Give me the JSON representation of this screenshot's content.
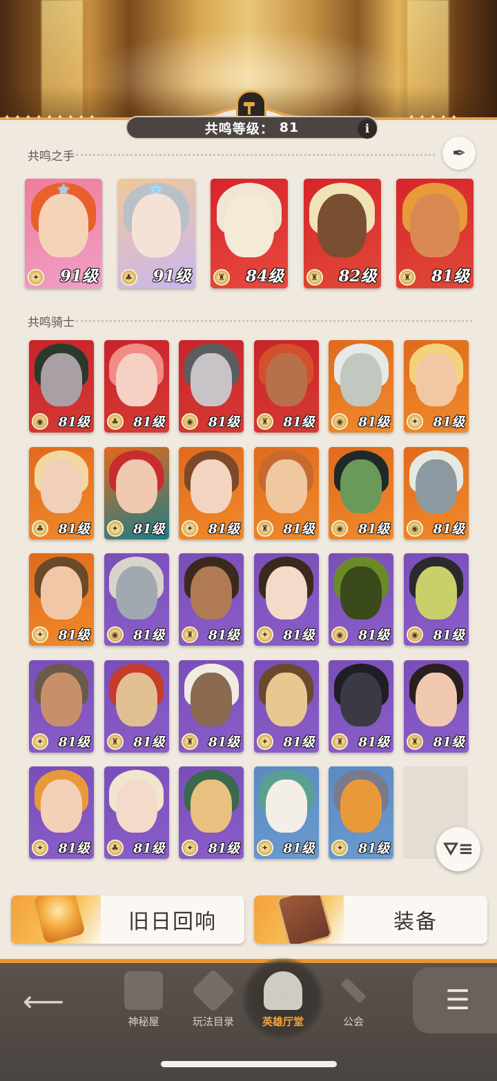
{
  "header": {
    "level_label": "共鸣等级：",
    "level_value": "81",
    "info_icon": "i"
  },
  "hands": {
    "title": "共鸣之手",
    "cards": [
      {
        "level": "91级",
        "faction": "lightbearer",
        "starred": true,
        "palette": [
          "#f07c9a",
          "#f0a0c8",
          "#e8602c",
          "#f5d3b8"
        ]
      },
      {
        "level": "91级",
        "faction": "wilder",
        "starred": true,
        "palette": [
          "#f0c89a",
          "#c8b6f0",
          "#b9c0c8",
          "#f5e2d6"
        ]
      },
      {
        "level": "84级",
        "faction": "graveborn-gold",
        "starred": false,
        "palette": [
          "#d8242a",
          "#e84a40",
          "#f1e6d4",
          "#f4ead8"
        ]
      },
      {
        "level": "82级",
        "faction": "graveborn-gold",
        "starred": false,
        "palette": [
          "#d8242a",
          "#e04a38",
          "#f1e3b8",
          "#7a4e30"
        ]
      },
      {
        "level": "81级",
        "faction": "graveborn-gold",
        "starred": false,
        "palette": [
          "#d8242a",
          "#e04a38",
          "#e99a3a",
          "#d98a52"
        ]
      }
    ]
  },
  "knights": {
    "title": "共鸣骑士",
    "cards": [
      {
        "level": "81级",
        "faction": "mauler",
        "palette": [
          "#c8242a",
          "#d63a34",
          "#2a3a2a",
          "#a8a0a4"
        ]
      },
      {
        "level": "81级",
        "faction": "wilder",
        "palette": [
          "#c8242a",
          "#d63a34",
          "#f28a86",
          "#f7d0c4"
        ]
      },
      {
        "level": "81级",
        "faction": "mauler",
        "palette": [
          "#c8242a",
          "#d63a34",
          "#5a5e62",
          "#c8c4c6"
        ]
      },
      {
        "level": "81级",
        "faction": "graveborn-gold",
        "palette": [
          "#c8242a",
          "#d63a34",
          "#d4502c",
          "#b8704a"
        ]
      },
      {
        "level": "81级",
        "faction": "mauler",
        "palette": [
          "#e06a1c",
          "#f08a2c",
          "#e8e8e8",
          "#c0c8c0"
        ]
      },
      {
        "level": "81级",
        "faction": "lightbearer",
        "palette": [
          "#e06a1c",
          "#f08a2c",
          "#f4d27a",
          "#f2c8a4"
        ]
      },
      {
        "level": "81级",
        "faction": "wilder",
        "palette": [
          "#e06a1c",
          "#f08a2c",
          "#f2d8a0",
          "#f0d0b8"
        ]
      },
      {
        "level": "81级",
        "faction": "lightbearer",
        "palette": [
          "#e06a1c",
          "#1a7e8a",
          "#c82c2c",
          "#f0c8b0"
        ]
      },
      {
        "level": "81级",
        "faction": "lightbearer",
        "palette": [
          "#e06a1c",
          "#f08a2c",
          "#7a4a2a",
          "#f2d4c0"
        ]
      },
      {
        "level": "81级",
        "faction": "graveborn-gold",
        "palette": [
          "#e06a1c",
          "#f08a2c",
          "#c86a30",
          "#f0c8a0"
        ]
      },
      {
        "level": "81级",
        "faction": "mauler",
        "palette": [
          "#e06a1c",
          "#f08a2c",
          "#1e2a2a",
          "#6a9a5a"
        ]
      },
      {
        "level": "81级",
        "faction": "mauler",
        "palette": [
          "#e06a1c",
          "#f08a2c",
          "#e8e8e2",
          "#8a9aa0"
        ]
      },
      {
        "level": "81级",
        "faction": "lightbearer",
        "palette": [
          "#e06a1c",
          "#f08a2c",
          "#6a4a2a",
          "#f0c8a8"
        ]
      },
      {
        "level": "81级",
        "faction": "mauler",
        "palette": [
          "#7a4eb8",
          "#8a5ec8",
          "#d8d4cc",
          "#a0a8b0"
        ]
      },
      {
        "level": "81级",
        "faction": "graveborn-gold",
        "palette": [
          "#7a4eb8",
          "#8a5ec8",
          "#3a2a1e",
          "#b07a52"
        ]
      },
      {
        "level": "81级",
        "faction": "lightbearer",
        "palette": [
          "#7a4eb8",
          "#8a5ec8",
          "#3a2a1e",
          "#f4dac8"
        ]
      },
      {
        "level": "81级",
        "faction": "mauler",
        "palette": [
          "#7a4eb8",
          "#8a5ec8",
          "#6a8a2a",
          "#3a4a1a"
        ]
      },
      {
        "level": "81级",
        "faction": "mauler",
        "palette": [
          "#7a4eb8",
          "#8a5ec8",
          "#2a2a2e",
          "#c8d06a"
        ]
      },
      {
        "level": "81级",
        "faction": "lightbearer",
        "palette": [
          "#7a4eb8",
          "#8a5ec8",
          "#6a5a4a",
          "#c8906a"
        ]
      },
      {
        "level": "81级",
        "faction": "graveborn-gold",
        "palette": [
          "#7a4eb8",
          "#8a5ec8",
          "#c83a2a",
          "#e0c090"
        ]
      },
      {
        "level": "81级",
        "faction": "graveborn-gold",
        "palette": [
          "#7a4eb8",
          "#8a5ec8",
          "#f0ece4",
          "#8a6a50"
        ]
      },
      {
        "level": "81级",
        "faction": "lightbearer",
        "palette": [
          "#7a4eb8",
          "#8a5ec8",
          "#6a4a2a",
          "#e8c890"
        ]
      },
      {
        "level": "81级",
        "faction": "graveborn-gold",
        "palette": [
          "#7a4eb8",
          "#8a5ec8",
          "#1e1e24",
          "#3a3a44"
        ]
      },
      {
        "level": "81级",
        "faction": "graveborn-gold",
        "palette": [
          "#7a4eb8",
          "#8a5ec8",
          "#2a1e1e",
          "#f0c8b0"
        ]
      },
      {
        "level": "81级",
        "faction": "lightbearer",
        "palette": [
          "#7a4eb8",
          "#8a5ec8",
          "#e89a3a",
          "#f4d0b8"
        ]
      },
      {
        "level": "81级",
        "faction": "wilder",
        "palette": [
          "#7a4eb8",
          "#8a5ec8",
          "#f0e6d0",
          "#f4dac8"
        ]
      },
      {
        "level": "81级",
        "faction": "lightbearer",
        "palette": [
          "#7a4eb8",
          "#8a5ec8",
          "#3a6a4a",
          "#e8c080"
        ]
      },
      {
        "level": "81级",
        "faction": "lightbearer",
        "palette": [
          "#5a8ac0",
          "#6a9ad0",
          "#5aa090",
          "#f4eee8"
        ]
      },
      {
        "level": "81级",
        "faction": "lightbearer",
        "palette": [
          "#5a8ac0",
          "#6a9ad0",
          "#7a7a8a",
          "#e89a3a"
        ]
      }
    ]
  },
  "actions": {
    "echoes_label": "旧日回响",
    "equipment_label": "装备"
  },
  "nav": {
    "items": [
      {
        "label": "神秘屋",
        "icon": "tower-icon"
      },
      {
        "label": "玩法目录",
        "icon": "diamond-grid-icon"
      },
      {
        "label": "英雄厅堂",
        "icon": "knight-helmet-icon",
        "active": true
      },
      {
        "label": "公会",
        "icon": "crossed-swords-icon"
      }
    ],
    "accent_color": "#e9952f"
  }
}
